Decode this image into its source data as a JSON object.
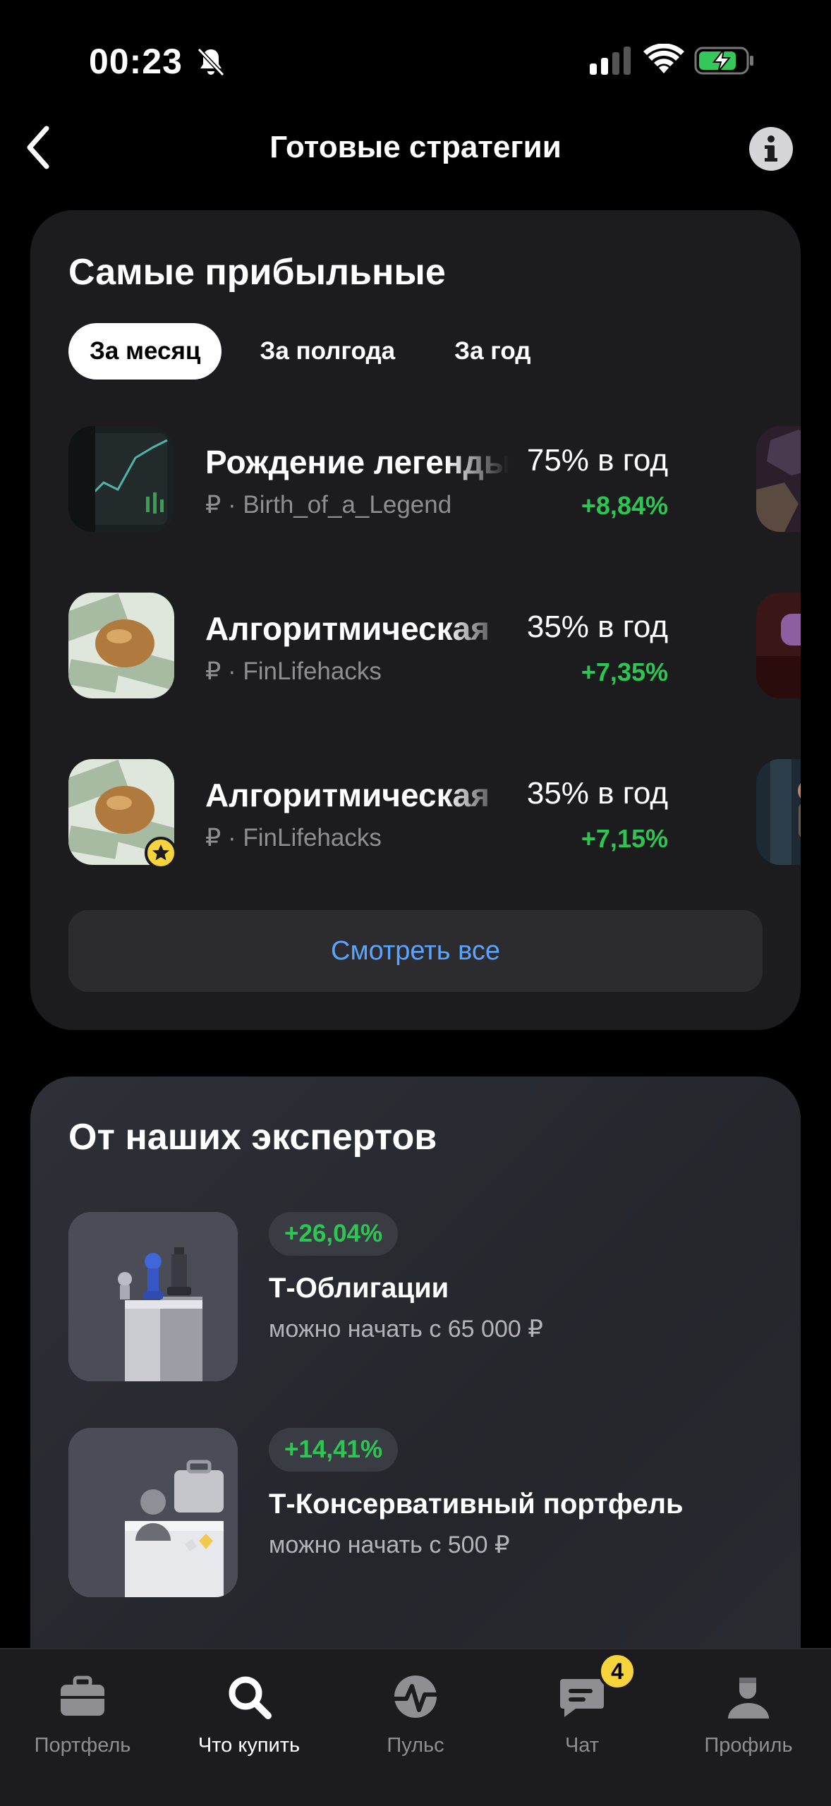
{
  "status_bar": {
    "time": "00:23"
  },
  "header": {
    "title": "Готовые стратегии"
  },
  "profitable": {
    "title": "Самые прибыльные",
    "tabs": [
      {
        "label": "За месяц",
        "active": true
      },
      {
        "label": "За полгода",
        "active": false
      },
      {
        "label": "За год",
        "active": false
      }
    ],
    "items": [
      {
        "name": "Рождение легенды",
        "author": "₽ · Birth_of_a_Legend",
        "rate": "75% в год",
        "gain": "+8,84%"
      },
      {
        "name": "Алгоритмическая",
        "author": "₽ · FinLifehacks",
        "rate": "35% в год",
        "gain": "+7,35%"
      },
      {
        "name": "Алгоритмическая",
        "author": "₽ · FinLifehacks",
        "rate": "35% в год",
        "gain": "+7,15%"
      }
    ],
    "see_all": "Смотреть все"
  },
  "experts": {
    "title": "От наших экспертов",
    "items": [
      {
        "badge": "+26,04%",
        "title": "Т-Облигации",
        "subtitle": "можно начать с 65 000 ₽"
      },
      {
        "badge": "+14,41%",
        "title": "Т-Консервативный портфель",
        "subtitle": "можно начать с 500 ₽"
      }
    ]
  },
  "tabbar": {
    "items": [
      {
        "label": "Портфель",
        "icon": "briefcase-icon"
      },
      {
        "label": "Что купить",
        "icon": "search-icon",
        "active": true
      },
      {
        "label": "Пульс",
        "icon": "pulse-icon"
      },
      {
        "label": "Чат",
        "icon": "chat-icon",
        "badge": "4"
      },
      {
        "label": "Профиль",
        "icon": "profile-icon"
      }
    ]
  },
  "colors": {
    "accent_link": "#5aa3ff",
    "gain": "#2ec653",
    "badge": "#f7d43c"
  }
}
